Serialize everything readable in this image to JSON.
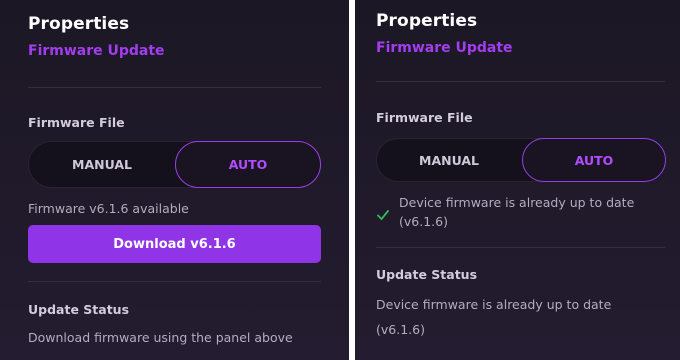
{
  "left": {
    "title": "Properties",
    "subtitle": "Firmware Update",
    "firmware_file_label": "Firmware File",
    "mode_manual": "MANUAL",
    "mode_auto": "AUTO",
    "available_text": "Firmware v6.1.6 available",
    "download_button": "Download v6.1.6",
    "update_status_label": "Update Status",
    "status_text": "Download firmware using the panel above"
  },
  "right": {
    "title": "Properties",
    "subtitle": "Firmware Update",
    "firmware_file_label": "Firmware File",
    "mode_manual": "MANUAL",
    "mode_auto": "AUTO",
    "uptodate_line1": "Device firmware is already up to date",
    "uptodate_line2": "(v6.1.6)",
    "update_status_label": "Update Status",
    "status_line1": "Device firmware is already up to date",
    "status_line2": "(v6.1.6)"
  },
  "icons": {
    "check": "check-icon"
  },
  "colors": {
    "accent": "#a23df0",
    "button": "#8f34e6",
    "check": "#2fbf5a",
    "panel_bg": "#1f1a29"
  }
}
